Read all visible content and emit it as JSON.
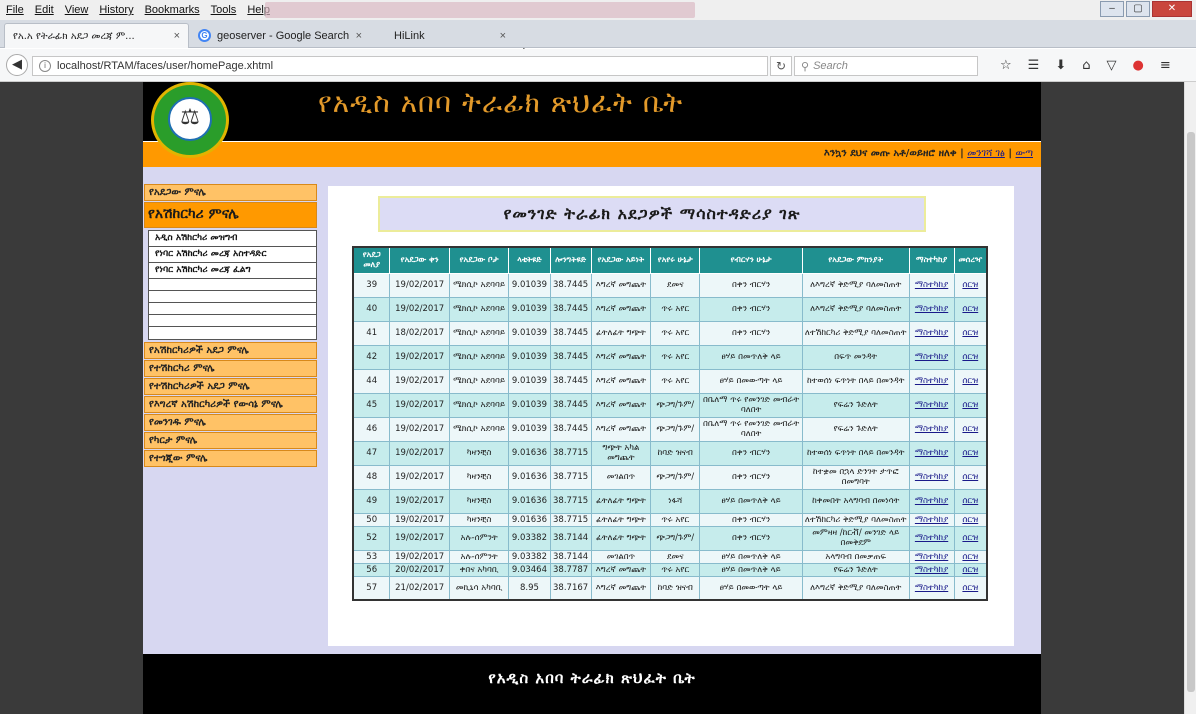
{
  "browser": {
    "menu": [
      "File",
      "Edit",
      "View",
      "History",
      "Bookmarks",
      "Tools",
      "Help"
    ],
    "tabs": [
      {
        "label": "የአ.አ የትራፊክ አደጋ መረጃ ም..."
      },
      {
        "label": "geoserver - Google Search"
      },
      {
        "label": "HiLink"
      }
    ],
    "url": "localhost/RTAM/faces/user/homePage.xhtml",
    "search_placeholder": "Search"
  },
  "header": {
    "title": "የአዲስ አበባ ትራፊክ ጽህፈት ቤት",
    "welcome": "እንኳን ደህና መጡ  አቶ/ወይዘሮ ዘለቀ |",
    "link_password": "መንገሻ ገፅ",
    "link_logout": "ውጣ"
  },
  "sidebar": {
    "item_accident_report": "የአደጋው ምናሌ",
    "driver_header": "የአሽከርካሪ ምናሌ",
    "sub": [
      "አዲስ አሽከርካሪ መዝግብ",
      "የነባር አሽከርካሪ መረጃ አስተዳድር",
      "የነባር አሽከርካሪ መረጃ ፈልግ"
    ],
    "menu": [
      "የአሽከርካሪዎች አደጋ ምናሌ",
      "የተሽከርካሪ ምናሌ",
      "የተሽከርካሪዎች አደጋ ምናሌ",
      "የእግረኛ አሽከርካሪዎች የውሳኔ ምናሌ",
      "የመንገዱ ምናሌ",
      "የካርታ ምናሌ",
      "የተጎጂው ምናሌ"
    ]
  },
  "main": {
    "title": "የመንገድ ትራፊክ አደጋዎች ማሳስተዳድሪያ ገጽ"
  },
  "table": {
    "headers": [
      "የአደጋ መለያ",
      "የአደጋው ቀን",
      "የአደጋው ቦታ",
      "ላቲትዩድ",
      "ሎንግትዩድ",
      "የአደጋው አይነት",
      "የአየሩ ሁኔታ",
      "የብርሃን ሁኔታ",
      "የአደጋው ምክንያት",
      "ማስተካከያ",
      "መሰረዣ"
    ],
    "rows": [
      [
        "39",
        "19/02/2017",
        "ሜክሲኮ አደባባይ",
        "9.01039",
        "38.7445",
        "እግረኛ መግጨት",
        "ደመና",
        "በቀን ብርሃን",
        "ለእግረኛ ቅድሚያ ባለመስጠት",
        "ማስተካከያ",
        "ሰርዝ"
      ],
      [
        "40",
        "19/02/2017",
        "ሜክሲኮ አደባባይ",
        "9.01039",
        "38.7445",
        "እግረኛ መግጨት",
        "ጥሩ አየር",
        "በቀን ብርሃን",
        "ለእግረኛ ቅድሚያ ባለመስጠት",
        "ማስተካከያ",
        "ሰርዝ"
      ],
      [
        "41",
        "18/02/2017",
        "ሜክሲኮ አደባባይ",
        "9.01039",
        "38.7445",
        "ፊትለፊት ግጭት",
        "ጥሩ አየር",
        "በቀን ብርሃን",
        "ለተሽከርካሪ ቅድሚያ ባለመስጠት",
        "ማስተካከያ",
        "ሰርዝ"
      ],
      [
        "42",
        "19/02/2017",
        "ሜክሲኮ አደባባይ",
        "9.01039",
        "38.7445",
        "እግረኛ መግጨት",
        "ጥሩ አየር",
        "ፀሃይ በመጥለቅ ላይ",
        "በፍጥ መንዳት",
        "ማስተካከያ",
        "ሰርዝ"
      ],
      [
        "44",
        "19/02/2017",
        "ሜክሲኮ አደባባይ",
        "9.01039",
        "38.7445",
        "እግረኛ መግጨት",
        "ጥሩ አየር",
        "ፀሃይ በመውጣት ላይ",
        "ከተወሰነ ፍጥነት በላይ በመንዳት",
        "ማስተካከያ",
        "ሰርዝ"
      ],
      [
        "45",
        "19/02/2017",
        "ሜክሲኮ አደባባይ",
        "9.01039",
        "38.7445",
        "እግረኛ መግጨት",
        "ጭጋግ/ጉም/",
        "በቤለማ ጥሩ የመንገድ መብራት ባለበት",
        "የፍሬን ጉድለት",
        "ማስተካከያ",
        "ሰርዝ"
      ],
      [
        "46",
        "19/02/2017",
        "ሜክሲኮ አደባባይ",
        "9.01039",
        "38.7445",
        "እግረኛ መግጨት",
        "ጭጋግ/ጉም/",
        "በቤለማ ጥሩ የመንገድ መብራት ባለበት",
        "የፍሬን ጉድለት",
        "ማስተካከያ",
        "ሰርዝ"
      ],
      [
        "47",
        "19/02/2017",
        "ካዛንቺስ",
        "9.01636",
        "38.7715",
        "ግጭት አካል መግጨት",
        "ከባድ ዝናብ",
        "በቀን ብርሃን",
        "ከተወሰነ ፍጥነት በላይ በመንዳት",
        "ማስተካከያ",
        "ሰርዝ"
      ],
      [
        "48",
        "19/02/2017",
        "ካዛንቺስ",
        "9.01636",
        "38.7715",
        "መገልበጥ",
        "ጭጋግ/ጉም/",
        "በቀን ብርሃን",
        "ከተቋመ በኋላ ድንገት ታጥፎ በመግባት",
        "ማስተካከያ",
        "ሰርዝ"
      ],
      [
        "49",
        "19/02/2017",
        "ካዛንቺስ",
        "9.01636",
        "38.7715",
        "ፊትለፊት ግጭት",
        "ነፋሻ",
        "ፀሃይ በመጥለቅ ላይ",
        "ከቀመበት አላግባብ በመነሳት",
        "ማስተካከያ",
        "ሰርዝ"
      ],
      [
        "50",
        "19/02/2017",
        "ካዛንቺስ",
        "9.01636",
        "38.7715",
        "ፊትለፊት ግጭት",
        "ጥሩ አየር",
        "በቀን ብርሃን",
        "ለተሽከርካሪ ቅድሚያ ባለመስጠት",
        "ማስተካከያ",
        "ሰርዝ"
      ],
      [
        "52",
        "19/02/2017",
        "አሉ-ሰምንት",
        "9.03382",
        "38.7144",
        "ፊትለፊት ግጭት",
        "ጭጋግ/ጉም/",
        "በቀን ብርሃን",
        "መምዛዛ /ከርቭ/ መንገድ ላይ በመቅደም",
        "ማስተካከያ",
        "ሰርዝ"
      ],
      [
        "53",
        "19/02/2017",
        "አሉ-ሰምንት",
        "9.03382",
        "38.7144",
        "መገልበጥ",
        "ደመና",
        "ፀሃይ በመጥለቅ ላይ",
        "አላግባብ በመቃጠፍ",
        "ማስተካከያ",
        "ሰርዝ"
      ],
      [
        "56",
        "20/02/2017",
        "ቀበና አካባቢ",
        "9.03464",
        "38.7787",
        "እግረኛ መግጨት",
        "ጥሩ አየር",
        "ፀሃይ በመጥለቅ ላይ",
        "የፍሬን ጉድለት",
        "ማስተካከያ",
        "ሰርዝ"
      ],
      [
        "57",
        "21/02/2017",
        "መኪኒሳ አካባቢ",
        "8.95",
        "38.7167",
        "እግረኛ መግጨት",
        "ከባድ ዝናብ",
        "ፀሃይ በመውጣት ላይ",
        "ለእግረኛ ቅድሚያ ባለመስጠት",
        "ማስተካከያ",
        "ሰርዝ"
      ]
    ]
  },
  "footer": {
    "text": "የአዲስ አበባ ትራፊክ ጽህፈት ቤት"
  },
  "colors": {
    "header_bg": "#000000",
    "orange": "#ff9900",
    "table_header": "#1f9090",
    "row_alt": "#c6ecec",
    "page_bg": "#d7d7f1"
  }
}
